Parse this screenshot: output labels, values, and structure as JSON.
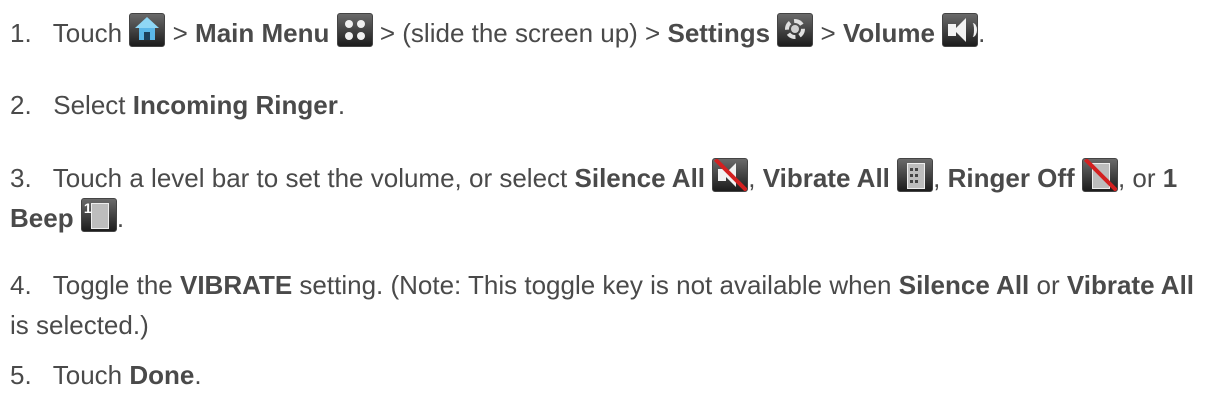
{
  "steps": [
    {
      "num": "1.",
      "touch": "Touch",
      "sep1": ">",
      "main_menu": "Main Menu",
      "sep2": "> (slide the screen up) >",
      "settings": "Settings",
      "sep3": ">",
      "volume": "Volume",
      "end": ".",
      "icons": [
        "home-icon",
        "main-menu-icon",
        "settings-gear-icon",
        "volume-speaker-icon"
      ]
    },
    {
      "num": "2.",
      "pre": "Select",
      "bold": "Incoming Ringer",
      "end": "."
    },
    {
      "num": "3.",
      "pre": "Touch a level bar to set the volume, or select",
      "silence_all": "Silence All",
      "sep1": ",",
      "vibrate_all": "Vibrate All",
      "sep2": ",",
      "ringer_off": "Ringer Off",
      "sep3": ", or",
      "one_beep": "1 Beep",
      "end": ".",
      "icons": [
        "silence-all-icon",
        "vibrate-all-icon",
        "ringer-off-icon",
        "one-beep-icon"
      ]
    },
    {
      "num": "4.",
      "pre": "Toggle the",
      "bold": "VIBRATE",
      "mid": "setting. (Note: This toggle key is not available when",
      "silence_all": "Silence All",
      "or": "or",
      "vibrate_all": "Vibrate All",
      "end": "is selected.)"
    },
    {
      "num": "5.",
      "pre": "Touch",
      "bold": "Done",
      "end": "."
    }
  ],
  "colors": {
    "text": "#4a4a4a",
    "icon_bg": "#2b2b2b",
    "slash": "#d32020",
    "home_accent": "#5bb7e8"
  }
}
